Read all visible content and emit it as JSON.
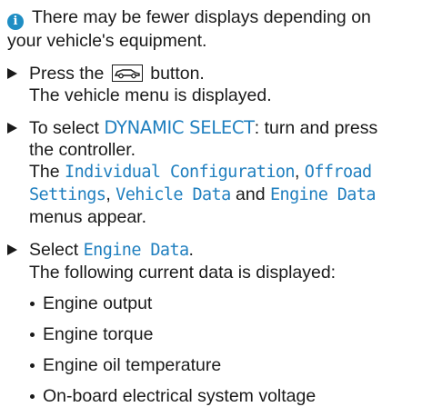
{
  "note": {
    "icon": "info-icon",
    "text_line1": "There may be fewer displays depending on",
    "text_line2": "your vehicle's equipment."
  },
  "step1": {
    "before": "Press the",
    "button_icon": "car-button-icon",
    "after": "button.",
    "result": "The vehicle menu is displayed."
  },
  "step2": {
    "prefix": "To select ",
    "dynamic_select": "DYNAMIC SELECT",
    "suffix": ": turn and press",
    "line2": "the controller.",
    "the": "The ",
    "menu1": "Individual Configuration",
    "comma1": ", ",
    "menu2_line1": "Offroad",
    "menu2_line2": "Settings",
    "comma2": ", ",
    "menu3": "Vehicle Data",
    "and": " and ",
    "menu4": "Engine Data",
    "end": "menus appear."
  },
  "step3": {
    "prefix": "Select ",
    "item": "Engine Data",
    "suffix": ".",
    "result": "The following current data is displayed:",
    "items": [
      "Engine output",
      "Engine torque",
      "Engine oil temperature",
      "On-board electrical system voltage"
    ]
  }
}
